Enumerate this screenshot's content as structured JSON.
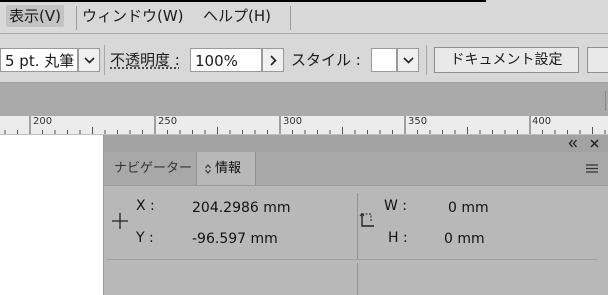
{
  "menu": {
    "items": [
      {
        "label": "表示(V)",
        "active": true
      },
      {
        "label": "ウィンドウ(W)"
      },
      {
        "label": "ヘルプ(H)"
      }
    ]
  },
  "control_bar": {
    "brush_value": "5 pt. 丸筆",
    "opacity_label": "不透明度 :",
    "opacity_value": "100%",
    "style_label": "スタイル :",
    "doc_settings_button": "ドキュメント設定"
  },
  "ruler": {
    "ticks": [
      "200",
      "250",
      "300",
      "350",
      "400"
    ]
  },
  "info_panel": {
    "tabs": [
      {
        "label": "ナビゲーター",
        "active": false
      },
      {
        "label": "情報",
        "active": true
      }
    ],
    "x_label": "X :",
    "x_value": "204.2986 mm",
    "y_label": "Y :",
    "y_value": "-96.597 mm",
    "w_label": "W :",
    "w_value": "0 mm",
    "h_label": "H :",
    "h_value": "0 mm"
  },
  "icons": {
    "collapse": "double-chevron-left-icon",
    "close": "close-icon",
    "menu": "hamburger-menu-icon",
    "crosshair": "crosshair-icon",
    "transform": "transform-box-icon"
  }
}
